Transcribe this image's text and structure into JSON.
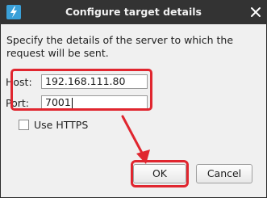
{
  "window": {
    "title": "Configure target details",
    "app_icon": "lightning-bolt-icon",
    "close_icon": "close-icon"
  },
  "dialog": {
    "description": "Specify the details of the server to which the request will be sent.",
    "host": {
      "label": "Host:",
      "value": "192.168.111.80"
    },
    "port": {
      "label": "Port:",
      "value": "7001"
    },
    "use_https": {
      "label": "Use HTTPS",
      "checked": false
    },
    "ok_label": "OK",
    "cancel_label": "Cancel"
  },
  "annotation": {
    "color": "#e0262f"
  },
  "colors": {
    "titlebar": "#333333",
    "dialog_bg": "#f0f0f0",
    "accent_icon": "#3aa0d8"
  }
}
